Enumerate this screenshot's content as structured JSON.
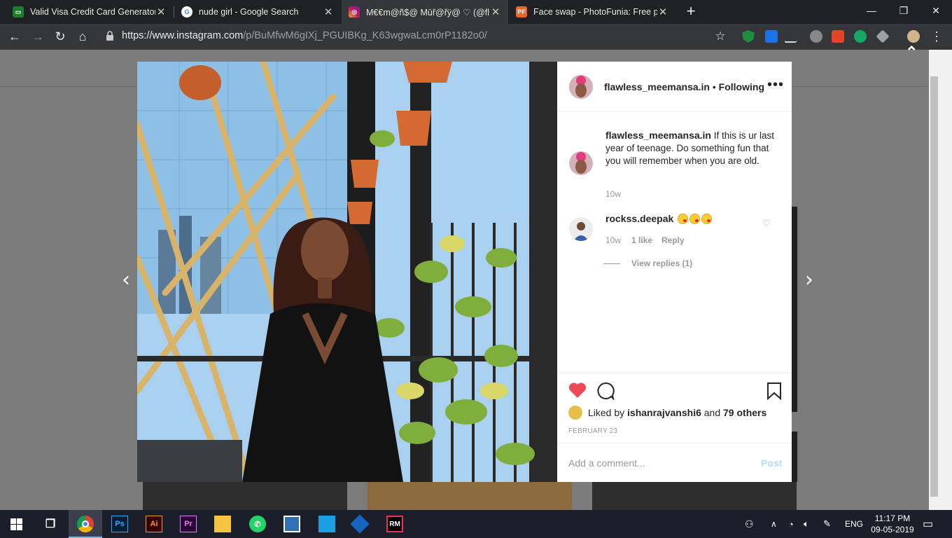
{
  "browser": {
    "tabs": [
      {
        "title": "Valid Visa Credit Card Generator",
        "icon": "card-generator-icon",
        "active": false
      },
      {
        "title": "nude girl - Google Search",
        "icon": "google-icon",
        "active": false
      },
      {
        "title": "M€€m@ñ$@ Mūř@řÿ@ ♡ (@fl",
        "icon": "instagram-icon",
        "active": true
      },
      {
        "title": "Face swap - PhotoFunia: Free pho",
        "icon": "photofunia-icon",
        "active": false
      }
    ],
    "url_host": "https://www.instagram.com",
    "url_path": "/p/BuMfwM6gIXj_PGUIBKg_K63wgwaLcm0rP1182o0/"
  },
  "post": {
    "username": "flawless_meemansa.in",
    "separator": "•",
    "follow_state": "Following",
    "caption_username": "flawless_meemansa.in",
    "caption_text": "If this is ur last year of teenage. Do something fun that you will remember when you are old.",
    "caption_age": "10w",
    "comments": [
      {
        "username": "rockss.deepak",
        "emoji_count": 3,
        "age": "10w",
        "likes": "1 like",
        "reply_label": "Reply",
        "view_replies": "View replies (1)"
      }
    ],
    "liked_by_prefix": "Liked by",
    "liked_by_user": "ishanrajvanshi6",
    "liked_by_conj": "and",
    "liked_by_others": "79 others",
    "date": "FEBRUARY 23",
    "add_comment_placeholder": "Add a comment...",
    "post_button": "Post",
    "liked": true,
    "colors": {
      "like": "#ed4956",
      "post_disabled": "#b3dbff"
    }
  },
  "taskbar": {
    "apps": [
      "chrome-icon",
      "photoshop-icon",
      "illustrator-icon",
      "premiere-icon",
      "file-explorer-icon",
      "whatsapp-icon",
      "app-icon",
      "share-icon",
      "virtualbox-icon",
      "rubymine-icon"
    ],
    "app_labels": {
      "photoshop": "Ps",
      "illustrator": "Ai",
      "premiere": "Pr",
      "rubymine": "RM"
    },
    "language": "ENG",
    "time": "11:17 PM",
    "date": "09-05-2019"
  }
}
